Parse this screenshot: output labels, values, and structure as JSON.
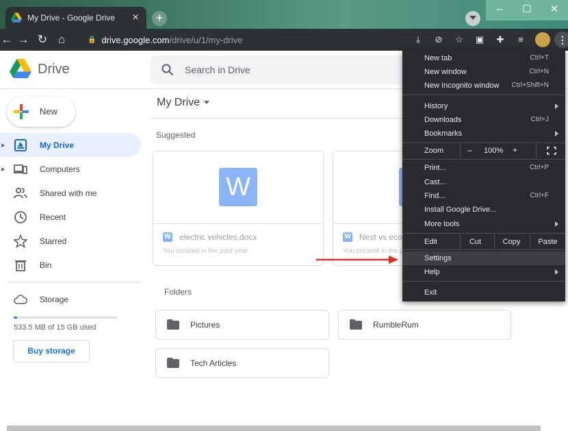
{
  "browser": {
    "tab_title": "My Drive - Google Drive",
    "tab_close": "×",
    "new_tab": "+",
    "url_host": "drive.google.com",
    "url_path": "/drive/u/1/my-drive",
    "window_min": "–",
    "window_max": "☐",
    "window_close": "✕"
  },
  "app": {
    "name": "Drive",
    "search_placeholder": "Search in Drive"
  },
  "sidebar": {
    "new_label": "New",
    "items": [
      {
        "label": "My Drive"
      },
      {
        "label": "Computers"
      },
      {
        "label": "Shared with me"
      },
      {
        "label": "Recent"
      },
      {
        "label": "Starred"
      },
      {
        "label": "Bin"
      }
    ],
    "storage_label": "Storage",
    "storage_used": "533.5 MB of 15 GB used",
    "storage_fraction": 0.035,
    "buy_storage": "Buy storage"
  },
  "main": {
    "title": "My Drive",
    "suggested_title": "Suggested",
    "files": [
      {
        "name": "electric vehicles.docx",
        "sub": "You created in the past year",
        "type_letter": "W"
      },
      {
        "name": "Nest vs ecol",
        "sub": "You created in the p",
        "type_letter": "W"
      }
    ],
    "folders_title": "Folders",
    "folders": [
      {
        "name": "Pictures"
      },
      {
        "name": "RumbleRum"
      },
      {
        "name": "Tech Articles"
      }
    ]
  },
  "chrome_menu": {
    "new_tab": "New tab",
    "new_tab_sc": "Ctrl+T",
    "new_window": "New window",
    "new_window_sc": "Ctrl+N",
    "new_incognito": "New Incognito window",
    "new_incognito_sc": "Ctrl+Shift+N",
    "history": "History",
    "downloads": "Downloads",
    "downloads_sc": "Ctrl+J",
    "bookmarks": "Bookmarks",
    "zoom": "Zoom",
    "zoom_minus": "–",
    "zoom_value": "100%",
    "zoom_plus": "+",
    "print": "Print...",
    "print_sc": "Ctrl+P",
    "cast": "Cast...",
    "find": "Find...",
    "find_sc": "Ctrl+F",
    "install": "Install Google Drive...",
    "more_tools": "More tools",
    "edit": "Edit",
    "cut": "Cut",
    "copy": "Copy",
    "paste": "Paste",
    "settings": "Settings",
    "help": "Help",
    "exit": "Exit"
  },
  "colors": {
    "accent": "#1a73e8",
    "menu_bg": "#292a2d",
    "arrow": "#d93025"
  }
}
